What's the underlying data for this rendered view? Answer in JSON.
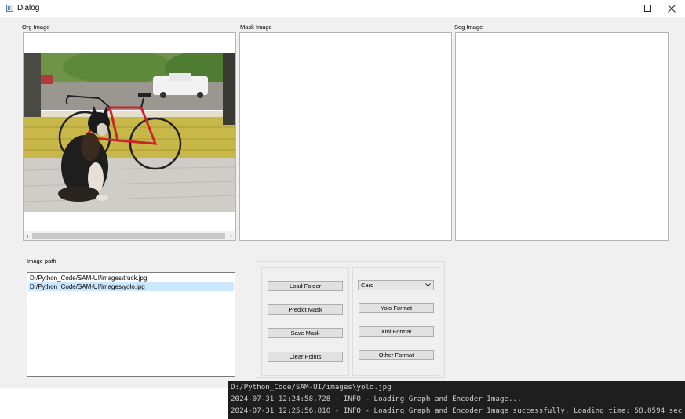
{
  "window": {
    "title": "Dialog",
    "minimize_icon": "minimize-icon",
    "maximize_icon": "maximize-icon",
    "close_icon": "close-icon"
  },
  "panels": {
    "org_label": "Org Image",
    "mask_label": "Mask Image",
    "seg_label": "Seg Image"
  },
  "image_path": {
    "label": "Image path",
    "items": [
      "D:/Python_Code/SAM-UI/images\\truck.jpg",
      "D:/Python_Code/SAM-UI/images\\yolo.jpg"
    ],
    "selected_index": 1
  },
  "actions": {
    "load_folder": "Load Folder",
    "predict_mask": "Predict Mask",
    "save_mask": "Save Mask",
    "clear_points": "Clear Points"
  },
  "export": {
    "format_select_value": "Card",
    "yolo_format": "Yolo Format",
    "xml_format": "Xml Format",
    "other_format": "Other Format"
  },
  "console": {
    "lines": [
      "D:/Python_Code/SAM-UI/images\\yolo.jpg",
      "2024-07-31 12:24:58,728 - INFO - Loading Graph and Encoder Image...",
      "2024-07-31 12:25:56,810 - INFO - Loading Graph and Encoder Image successfully, Loading time: 58.0594 sec"
    ]
  },
  "colors": {
    "window_bg": "#f0f0f0",
    "selection": "#cce8ff",
    "console_bg": "#1e1e1e"
  }
}
